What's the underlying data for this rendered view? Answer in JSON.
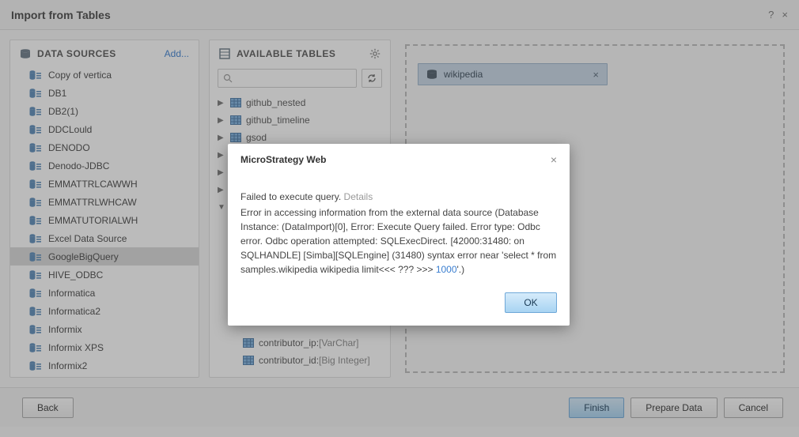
{
  "title": "Import from Tables",
  "sidebar": {
    "heading": "DATA SOURCES",
    "add_label": "Add...",
    "items": [
      {
        "label": "Copy of vertica"
      },
      {
        "label": "DB1"
      },
      {
        "label": "DB2(1)"
      },
      {
        "label": "DDCLould"
      },
      {
        "label": "DENODO"
      },
      {
        "label": "Denodo-JDBC"
      },
      {
        "label": "EMMATTRLCAWWH"
      },
      {
        "label": "EMMATTRLWHCAW"
      },
      {
        "label": "EMMATUTORIALWH"
      },
      {
        "label": "Excel Data Source"
      },
      {
        "label": "GoogleBigQuery",
        "selected": true
      },
      {
        "label": "HIVE_ODBC"
      },
      {
        "label": "Informatica"
      },
      {
        "label": "Informatica2"
      },
      {
        "label": "Informix"
      },
      {
        "label": "Informix XPS"
      },
      {
        "label": "Informix2"
      }
    ]
  },
  "tables": {
    "heading": "AVAILABLE TABLES",
    "search_placeholder": "",
    "tree": [
      {
        "label": "github_nested"
      },
      {
        "label": "github_timeline"
      },
      {
        "label": "gsod"
      }
    ],
    "columns": [
      {
        "name": "contributor_ip",
        "type": "[VarChar]"
      },
      {
        "name": "contributor_id",
        "type": "[Big Integer]"
      }
    ]
  },
  "canvas": {
    "chip_label": "wikipedia"
  },
  "footer": {
    "back": "Back",
    "finish": "Finish",
    "prepare": "Prepare Data",
    "cancel": "Cancel"
  },
  "dialog": {
    "title": "MicroStrategy Web",
    "line1": "Failed to execute query.",
    "details_label": "Details",
    "error_a": "Error in accessing information from the external data source (Database Instance: (DataImport)[0], Error: Execute Query failed. Error type: Odbc error. Odbc operation attempted: SQLExecDirect. [42000:31480: on SQLHANDLE] [Simba][SQLEngine] (31480) syntax error near 'select * from samples.wikipedia wikipedia limit<<< ??? >>> ",
    "error_num": "1000",
    "error_b": "'.)",
    "ok": "OK"
  }
}
